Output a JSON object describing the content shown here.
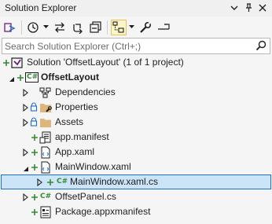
{
  "window": {
    "title": "Solution Explorer"
  },
  "search": {
    "placeholder": "Search Solution Explorer (Ctrl+;)"
  },
  "tree": {
    "solution": "Solution 'OffsetLayout' (1 of 1 project)",
    "project": "OffsetLayout",
    "dependencies": "Dependencies",
    "properties": "Properties",
    "assets": "Assets",
    "app_manifest": "app.manifest",
    "app_xaml": "App.xaml",
    "mainwindow_xaml": "MainWindow.xaml",
    "mainwindow_cs": "MainWindow.xaml.cs",
    "offsetpanel_cs": "OffsetPanel.cs",
    "package_manifest": "Package.appxmanifest",
    "cs_tag": "C#"
  },
  "colors": {
    "accent": "#1c6fc7",
    "selection": "#cce4f7",
    "git_add": "#388a34",
    "project_icon": "#68217a",
    "folder": "#dcb67a"
  }
}
